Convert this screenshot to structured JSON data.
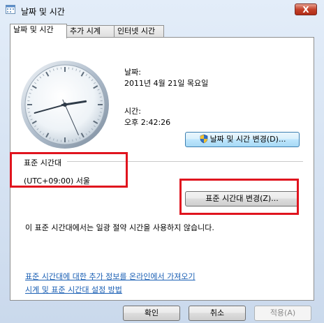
{
  "window": {
    "title": "날짜 및 시간",
    "close_label": "X"
  },
  "tabs": [
    {
      "label": "날짜 및 시간",
      "active": true
    },
    {
      "label": "추가 시계",
      "active": false
    },
    {
      "label": "인터넷 시간",
      "active": false
    }
  ],
  "date": {
    "label": "날짜:",
    "value": "2011년 4월 21일 목요일"
  },
  "time": {
    "label": "시간:",
    "value": "오후 2:42:26"
  },
  "change_datetime_button": "날짜 및 시간 변경(D)...",
  "timezone": {
    "heading": "표준 시간대",
    "value": "(UTC+09:00) 서울"
  },
  "change_timezone_button": "표준 시간대 변경(Z)...",
  "dst_notice": "이 표준 시간대에서는 일광 절약 시간을 사용하지 않습니다.",
  "links": [
    "표준 시간대에 대한 추가 정보를 온라인에서 가져오기",
    "시계 및 표준 시간대 설정 방법"
  ],
  "footer": {
    "ok": "확인",
    "cancel": "취소",
    "apply": "적용(A)"
  },
  "clock": {
    "hours": 2,
    "minutes": 42,
    "seconds": 26
  },
  "colors": {
    "highlight": "#e0141e",
    "link": "#1a5fb4"
  },
  "icons": {
    "app": "calendar-clock-icon",
    "uac": "uac-shield-icon",
    "close": "close-icon"
  }
}
